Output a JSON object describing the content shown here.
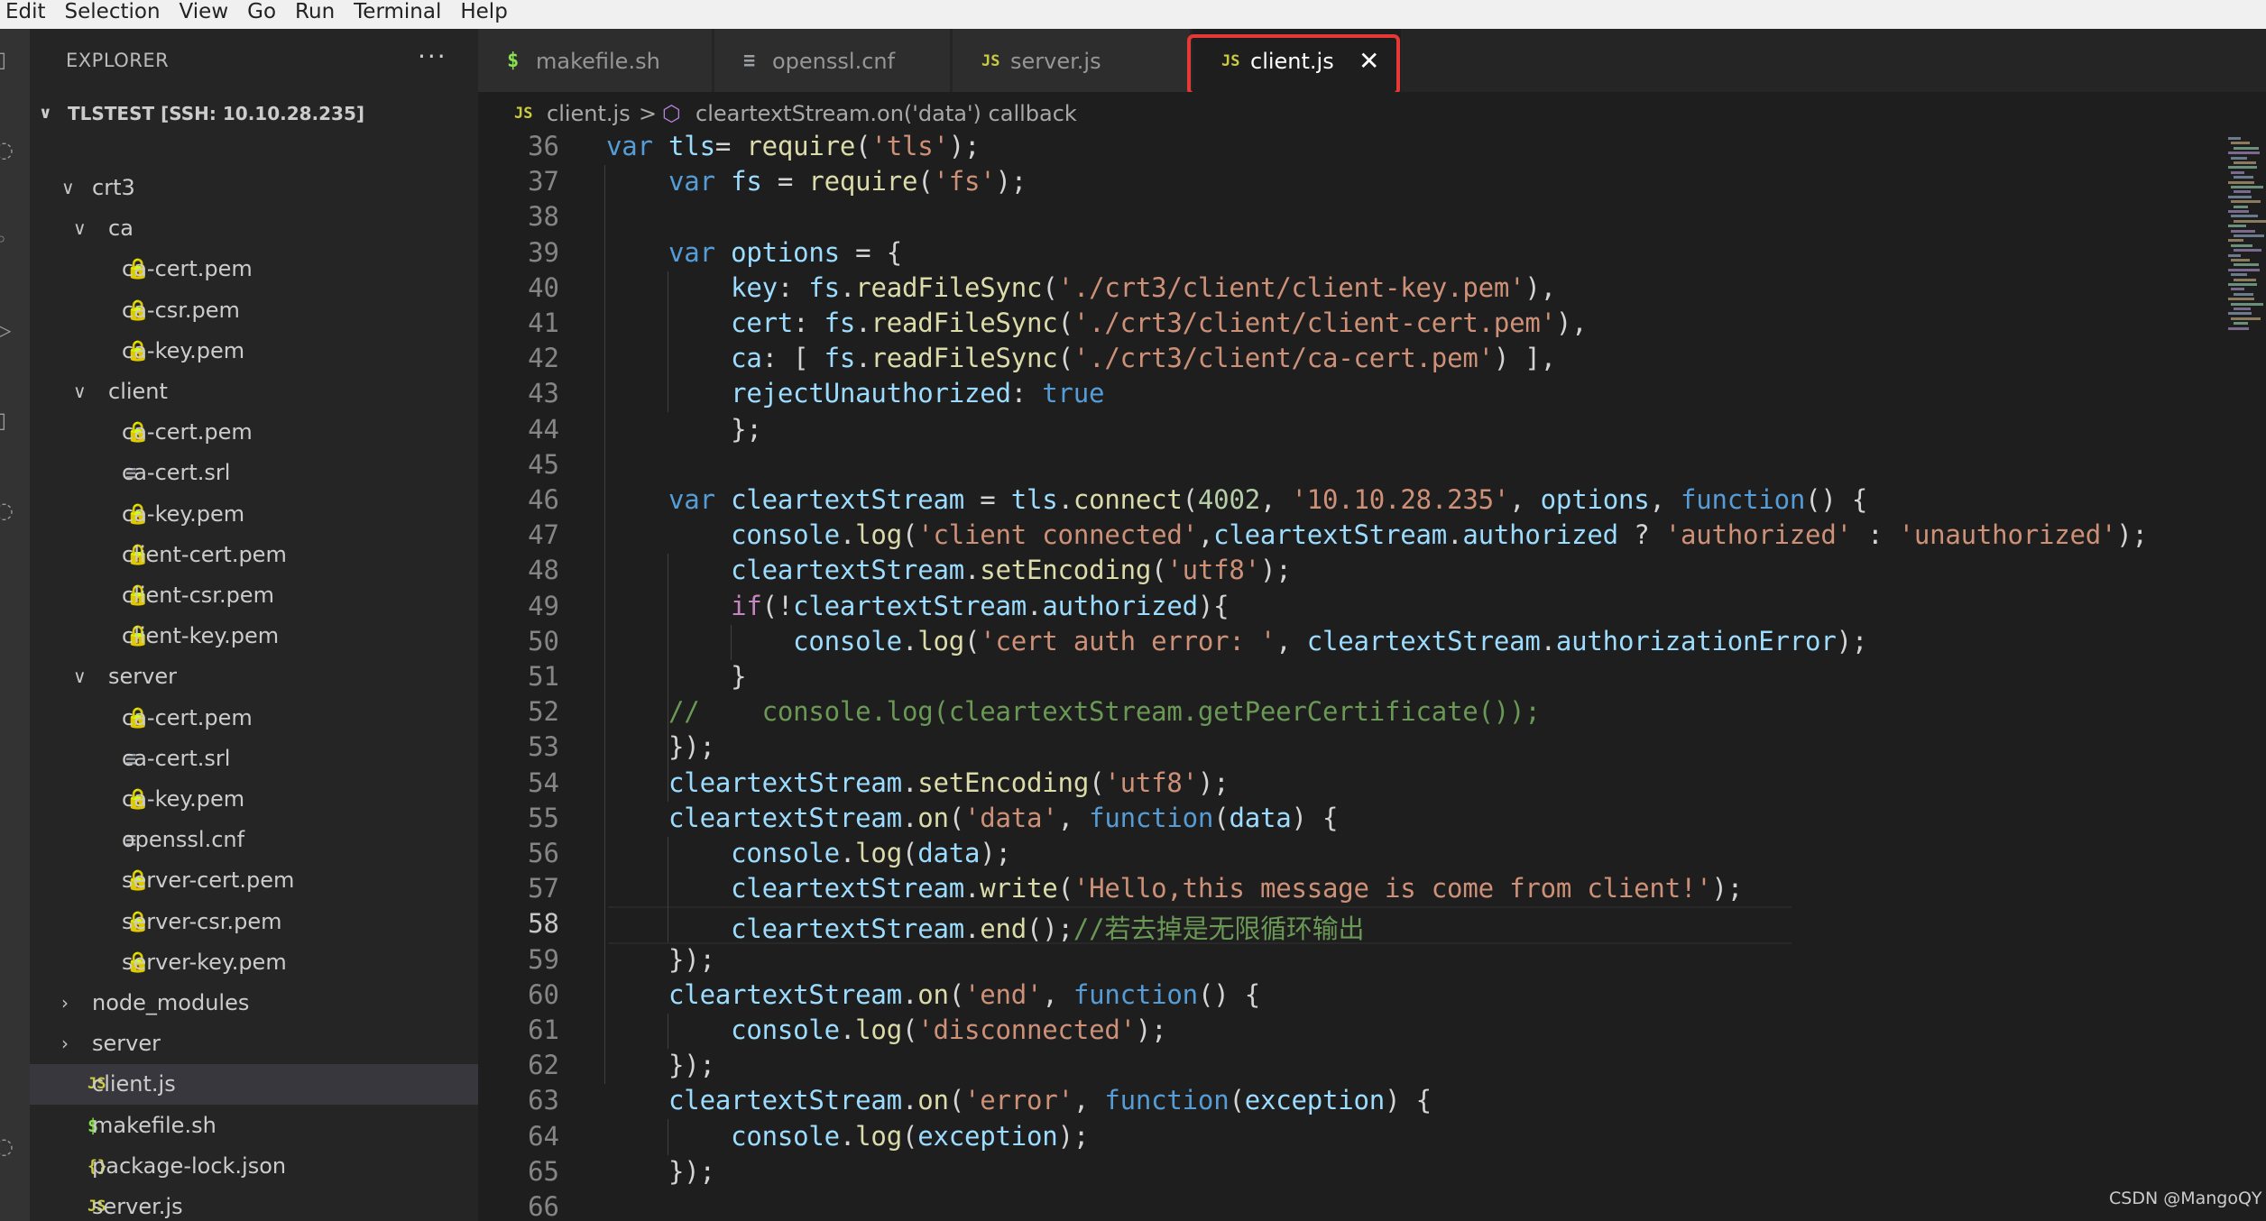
{
  "menu": [
    "Edit",
    "Selection",
    "View",
    "Go",
    "Run",
    "Terminal",
    "Help"
  ],
  "sidebar": {
    "title": "EXPLORER",
    "more": "···",
    "workspace": "TLSTEST [SSH: 10.10.28.235]",
    "tree": [
      {
        "label": "crt3",
        "type": "folder",
        "expanded": true,
        "depth": 0
      },
      {
        "label": "ca",
        "type": "folder",
        "expanded": true,
        "depth": 1
      },
      {
        "label": "ca-cert.pem",
        "type": "lock",
        "depth": 2
      },
      {
        "label": "ca-csr.pem",
        "type": "lock",
        "depth": 2
      },
      {
        "label": "ca-key.pem",
        "type": "lock",
        "depth": 2
      },
      {
        "label": "client",
        "type": "folder",
        "expanded": true,
        "depth": 1
      },
      {
        "label": "ca-cert.pem",
        "type": "lock",
        "depth": 2
      },
      {
        "label": "ca-cert.srl",
        "type": "lines",
        "depth": 2
      },
      {
        "label": "ca-key.pem",
        "type": "lock",
        "depth": 2
      },
      {
        "label": "client-cert.pem",
        "type": "lock",
        "depth": 2
      },
      {
        "label": "client-csr.pem",
        "type": "lock",
        "depth": 2
      },
      {
        "label": "client-key.pem",
        "type": "lock",
        "depth": 2
      },
      {
        "label": "server",
        "type": "folder",
        "expanded": true,
        "depth": 1
      },
      {
        "label": "ca-cert.pem",
        "type": "lock",
        "depth": 2
      },
      {
        "label": "ca-cert.srl",
        "type": "lines",
        "depth": 2
      },
      {
        "label": "ca-key.pem",
        "type": "lock",
        "depth": 2
      },
      {
        "label": "openssl.cnf",
        "type": "lines",
        "depth": 2
      },
      {
        "label": "server-cert.pem",
        "type": "lock",
        "depth": 2
      },
      {
        "label": "server-csr.pem",
        "type": "lock",
        "depth": 2
      },
      {
        "label": "server-key.pem",
        "type": "lock",
        "depth": 2
      },
      {
        "label": "node_modules",
        "type": "folder",
        "expanded": false,
        "depth": 0
      },
      {
        "label": "server",
        "type": "folder",
        "expanded": false,
        "depth": 0
      },
      {
        "label": "client.js",
        "type": "js",
        "depth": 0,
        "selected": true
      },
      {
        "label": "makefile.sh",
        "type": "dollar",
        "depth": 0
      },
      {
        "label": "package-lock.json",
        "type": "brace",
        "depth": 0
      },
      {
        "label": "server.js",
        "type": "js",
        "depth": 0
      }
    ]
  },
  "tabs": [
    {
      "icon": "$",
      "label": "makefile.sh",
      "active": false
    },
    {
      "icon": "≡",
      "label": "openssl.cnf",
      "active": false
    },
    {
      "icon": "JS",
      "label": "server.js",
      "active": false
    },
    {
      "icon": "JS",
      "label": "client.js",
      "active": true,
      "close": "✕"
    }
  ],
  "breadcrumb": {
    "file_icon": "JS",
    "file": "client.js",
    "separator": ">",
    "symbol_icon": "⬡",
    "symbol": "cleartextStream.on('data') callback"
  },
  "editor": {
    "current_line": 58,
    "lines": [
      {
        "n": "36",
        "t": [
          [
            "kw",
            "var "
          ],
          [
            "vr",
            "tls"
          ],
          [
            "",
            "="
          ],
          [
            "fn",
            " require"
          ],
          [
            "",
            "("
          ],
          [
            "st",
            "'tls'"
          ],
          [
            "",
            ");"
          ]
        ],
        "indent": 0
      },
      {
        "n": "37",
        "t": [
          [
            "",
            "    "
          ],
          [
            "kw",
            "var "
          ],
          [
            "vr",
            "fs"
          ],
          [
            "",
            " = "
          ],
          [
            "fn",
            "require"
          ],
          [
            "",
            "("
          ],
          [
            "st",
            "'fs'"
          ],
          [
            "",
            ");"
          ]
        ]
      },
      {
        "n": "38",
        "t": []
      },
      {
        "n": "39",
        "t": [
          [
            "",
            "    "
          ],
          [
            "kw",
            "var "
          ],
          [
            "vr",
            "options"
          ],
          [
            "",
            " = {"
          ]
        ]
      },
      {
        "n": "40",
        "t": [
          [
            "",
            "        "
          ],
          [
            "vr",
            "key"
          ],
          [
            "",
            ": "
          ],
          [
            "vr",
            "fs"
          ],
          [
            "",
            "."
          ],
          [
            "fn",
            "readFileSync"
          ],
          [
            "",
            "("
          ],
          [
            "st",
            "'./crt3/client/client-key.pem'"
          ],
          [
            "",
            "),"
          ]
        ]
      },
      {
        "n": "41",
        "t": [
          [
            "",
            "        "
          ],
          [
            "vr",
            "cert"
          ],
          [
            "",
            ": "
          ],
          [
            "vr",
            "fs"
          ],
          [
            "",
            "."
          ],
          [
            "fn",
            "readFileSync"
          ],
          [
            "",
            "("
          ],
          [
            "st",
            "'./crt3/client/client-cert.pem'"
          ],
          [
            "",
            "),"
          ]
        ]
      },
      {
        "n": "42",
        "t": [
          [
            "",
            "        "
          ],
          [
            "vr",
            "ca"
          ],
          [
            "",
            ": [ "
          ],
          [
            "vr",
            "fs"
          ],
          [
            "",
            "."
          ],
          [
            "fn",
            "readFileSync"
          ],
          [
            "",
            "("
          ],
          [
            "st",
            "'./crt3/client/ca-cert.pem'"
          ],
          [
            "",
            ") ],"
          ]
        ]
      },
      {
        "n": "43",
        "t": [
          [
            "",
            "        "
          ],
          [
            "vr",
            "rejectUnauthorized"
          ],
          [
            "",
            ": "
          ],
          [
            "kw",
            "true"
          ]
        ]
      },
      {
        "n": "44",
        "t": [
          [
            "",
            "        };"
          ]
        ]
      },
      {
        "n": "45",
        "t": []
      },
      {
        "n": "46",
        "t": [
          [
            "",
            "    "
          ],
          [
            "kw",
            "var "
          ],
          [
            "vr",
            "cleartextStream"
          ],
          [
            "",
            " = "
          ],
          [
            "vr",
            "tls"
          ],
          [
            "",
            "."
          ],
          [
            "fn",
            "connect"
          ],
          [
            "",
            "("
          ],
          [
            "nm",
            "4002"
          ],
          [
            "",
            ", "
          ],
          [
            "st",
            "'10.10.28.235'"
          ],
          [
            "",
            ", "
          ],
          [
            "vr",
            "options"
          ],
          [
            "",
            ", "
          ],
          [
            "kw",
            "function"
          ],
          [
            "",
            "() {"
          ]
        ]
      },
      {
        "n": "47",
        "t": [
          [
            "",
            "        "
          ],
          [
            "vr",
            "console"
          ],
          [
            "",
            "."
          ],
          [
            "fn",
            "log"
          ],
          [
            "",
            "("
          ],
          [
            "st",
            "'client connected'"
          ],
          [
            "",
            ","
          ],
          [
            "vr",
            "cleartextStream"
          ],
          [
            "",
            "."
          ],
          [
            "vr",
            "authorized"
          ],
          [
            "",
            " ? "
          ],
          [
            "st",
            "'authorized'"
          ],
          [
            "",
            " : "
          ],
          [
            "st",
            "'unauthorized'"
          ],
          [
            "",
            ");"
          ]
        ]
      },
      {
        "n": "48",
        "t": [
          [
            "",
            "        "
          ],
          [
            "vr",
            "cleartextStream"
          ],
          [
            "",
            "."
          ],
          [
            "fn",
            "setEncoding"
          ],
          [
            "",
            "("
          ],
          [
            "st",
            "'utf8'"
          ],
          [
            "",
            ");"
          ]
        ]
      },
      {
        "n": "49",
        "t": [
          [
            "",
            "        "
          ],
          [
            "cf",
            "if"
          ],
          [
            "",
            "(!"
          ],
          [
            "vr",
            "cleartextStream"
          ],
          [
            "",
            "."
          ],
          [
            "vr",
            "authorized"
          ],
          [
            "",
            "){"
          ]
        ]
      },
      {
        "n": "50",
        "t": [
          [
            "",
            "            "
          ],
          [
            "vr",
            "console"
          ],
          [
            "",
            "."
          ],
          [
            "fn",
            "log"
          ],
          [
            "",
            "("
          ],
          [
            "st",
            "'cert auth error: '"
          ],
          [
            "",
            ", "
          ],
          [
            "vr",
            "cleartextStream"
          ],
          [
            "",
            "."
          ],
          [
            "vr",
            "authorizationError"
          ],
          [
            "",
            ");"
          ]
        ]
      },
      {
        "n": "51",
        "t": [
          [
            "",
            "        }"
          ]
        ]
      },
      {
        "n": "52",
        "t": [
          [
            "",
            "    "
          ],
          [
            "cm",
            "//    console.log(cleartextStream.getPeerCertificate());"
          ]
        ]
      },
      {
        "n": "53",
        "t": [
          [
            "",
            "    });"
          ]
        ]
      },
      {
        "n": "54",
        "t": [
          [
            "",
            "    "
          ],
          [
            "vr",
            "cleartextStream"
          ],
          [
            "",
            "."
          ],
          [
            "fn",
            "setEncoding"
          ],
          [
            "",
            "("
          ],
          [
            "st",
            "'utf8'"
          ],
          [
            "",
            ");"
          ]
        ]
      },
      {
        "n": "55",
        "t": [
          [
            "",
            "    "
          ],
          [
            "vr",
            "cleartextStream"
          ],
          [
            "",
            "."
          ],
          [
            "fn",
            "on"
          ],
          [
            "",
            "("
          ],
          [
            "st",
            "'data'"
          ],
          [
            "",
            ", "
          ],
          [
            "kw",
            "function"
          ],
          [
            "",
            "("
          ],
          [
            "vr",
            "data"
          ],
          [
            "",
            ") {"
          ]
        ]
      },
      {
        "n": "56",
        "t": [
          [
            "",
            "        "
          ],
          [
            "vr",
            "console"
          ],
          [
            "",
            "."
          ],
          [
            "fn",
            "log"
          ],
          [
            "",
            "("
          ],
          [
            "vr",
            "data"
          ],
          [
            "",
            ");"
          ]
        ]
      },
      {
        "n": "57",
        "t": [
          [
            "",
            "        "
          ],
          [
            "vr",
            "cleartextStream"
          ],
          [
            "",
            "."
          ],
          [
            "fn",
            "write"
          ],
          [
            "",
            "("
          ],
          [
            "st",
            "'Hello,this message is come from client!'"
          ],
          [
            "",
            ");"
          ]
        ]
      },
      {
        "n": "58",
        "t": [
          [
            "",
            "        "
          ],
          [
            "vr",
            "cleartextStream"
          ],
          [
            "",
            "."
          ],
          [
            "fn",
            "end"
          ],
          [
            "",
            "();"
          ],
          [
            "cm",
            "//若去掉是无限循环输出"
          ]
        ]
      },
      {
        "n": "59",
        "t": [
          [
            "",
            "    });"
          ]
        ]
      },
      {
        "n": "60",
        "t": [
          [
            "",
            "    "
          ],
          [
            "vr",
            "cleartextStream"
          ],
          [
            "",
            "."
          ],
          [
            "fn",
            "on"
          ],
          [
            "",
            "("
          ],
          [
            "st",
            "'end'"
          ],
          [
            "",
            ", "
          ],
          [
            "kw",
            "function"
          ],
          [
            "",
            "() {"
          ]
        ]
      },
      {
        "n": "61",
        "t": [
          [
            "",
            "        "
          ],
          [
            "vr",
            "console"
          ],
          [
            "",
            "."
          ],
          [
            "fn",
            "log"
          ],
          [
            "",
            "("
          ],
          [
            "st",
            "'disconnected'"
          ],
          [
            "",
            ");"
          ]
        ]
      },
      {
        "n": "62",
        "t": [
          [
            "",
            "    });"
          ]
        ]
      },
      {
        "n": "63",
        "t": [
          [
            "",
            "    "
          ],
          [
            "vr",
            "cleartextStream"
          ],
          [
            "",
            "."
          ],
          [
            "fn",
            "on"
          ],
          [
            "",
            "("
          ],
          [
            "st",
            "'error'"
          ],
          [
            "",
            ", "
          ],
          [
            "kw",
            "function"
          ],
          [
            "",
            "("
          ],
          [
            "vr",
            "exception"
          ],
          [
            "",
            ") {"
          ]
        ]
      },
      {
        "n": "64",
        "t": [
          [
            "",
            "        "
          ],
          [
            "vr",
            "console"
          ],
          [
            "",
            "."
          ],
          [
            "fn",
            "log"
          ],
          [
            "",
            "("
          ],
          [
            "vr",
            "exception"
          ],
          [
            "",
            ");"
          ]
        ]
      },
      {
        "n": "65",
        "t": [
          [
            "",
            "    });"
          ]
        ]
      },
      {
        "n": "66",
        "t": []
      }
    ]
  },
  "watermark": "CSDN @MangoQY",
  "colors": {
    "highlight_border": "#e53935",
    "editor_bg": "#1e1e1e",
    "sidebar_bg": "#252526"
  }
}
